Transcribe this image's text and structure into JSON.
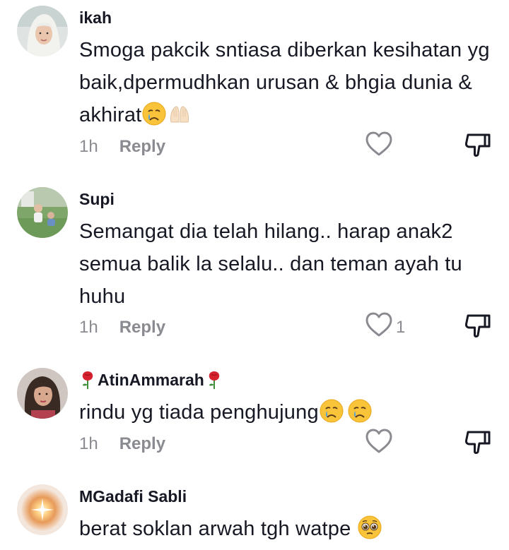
{
  "comments": [
    {
      "username": "ikah",
      "text": "Smoga pakcik sntiasa diberkan kesihatan yg baik,dpermudhkan urusan & bhgia dunia & akhirat",
      "emojis": [
        "crying-face",
        "pleading-hands"
      ],
      "time": "1h",
      "reply_label": "Reply",
      "like_count": ""
    },
    {
      "username": "Supi",
      "text": "Semangat dia telah hilang.. harap anak2 semua balik la selalu.. dan teman ayah tu huhu",
      "emojis": [],
      "time": "1h",
      "reply_label": "Reply",
      "like_count": "1"
    },
    {
      "username": "AtinAmmarah",
      "username_decoration": "rose",
      "text": "rindu yg tiada penghujung",
      "emojis": [
        "crying-face",
        "crying-face"
      ],
      "time": "1h",
      "reply_label": "Reply",
      "like_count": ""
    },
    {
      "username": "MGadafi Sabli",
      "text": "berat soklan arwah tgh watpe",
      "emojis": [
        "pleading-face"
      ],
      "time": "",
      "reply_label": "",
      "like_count": ""
    }
  ],
  "colors": {
    "primary_text": "#161823",
    "secondary_text": "#8a8b91",
    "icon_gray": "#8a8b91"
  }
}
